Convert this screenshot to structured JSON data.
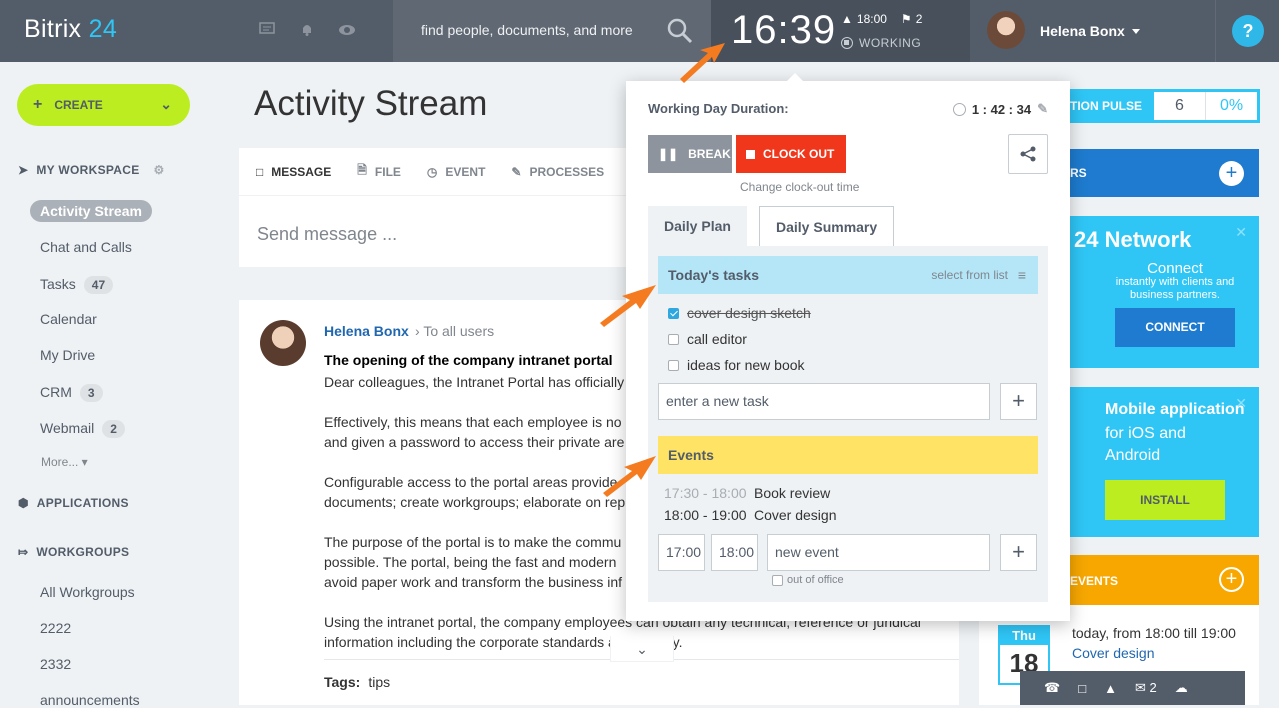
{
  "topbar": {
    "logo_main": "Bitrix",
    "logo_num": "24",
    "search_placeholder": "find people, documents, and more",
    "clock": "16:39",
    "alarm_time": "18:00",
    "flag_count": "2",
    "status": "WORKING",
    "user_name": "Helena Bonx",
    "help": "?"
  },
  "sidebar": {
    "create_label": "CREATE",
    "workspace_label": "MY WORKSPACE",
    "items": [
      {
        "label": "Activity Stream",
        "counter": ""
      },
      {
        "label": "Chat and Calls",
        "counter": ""
      },
      {
        "label": "Tasks",
        "counter": "47"
      },
      {
        "label": "Calendar",
        "counter": ""
      },
      {
        "label": "My Drive",
        "counter": ""
      },
      {
        "label": "CRM",
        "counter": "3"
      },
      {
        "label": "Webmail",
        "counter": "2"
      }
    ],
    "more_label": "More...",
    "applications_label": "APPLICATIONS",
    "workgroups_label": "WORKGROUPS",
    "workgroups": [
      "All Workgroups",
      "2222",
      "2332",
      "announcements"
    ]
  },
  "main": {
    "title": "Activity Stream",
    "composer_tabs": [
      "MESSAGE",
      "FILE",
      "EVENT",
      "PROCESSES"
    ],
    "send_placeholder": "Send message ...",
    "post": {
      "author": "Helena Bonx",
      "to": "To all users",
      "title": "The opening of the company intranet portal",
      "paragraphs": [
        "Dear colleagues, the Intranet Portal has officially",
        "Effectively, this means that each employee is no\nand given a password to access their private are",
        "Configurable access to the portal areas provide\ndocuments; create workgroups; elaborate on rep",
        "The purpose of the portal is to make the commu\npossible. The portal, being the fast and modern\navoid paper work and transform the business inf",
        "Using the intranet portal, the company employees can obtain any technical, reference or juridical\ninformation including the corporate standards and identity."
      ],
      "tags_label": "Tags:",
      "tags": "tips"
    }
  },
  "right": {
    "pulse_label": "TION PULSE",
    "pulse_value": "6",
    "pulse_percent": "0%",
    "widget1_label": "RS",
    "network_title": "24 Network",
    "network_caption": "Connect",
    "network_sub": "instantly with clients and business partners.",
    "connect_label": "CONNECT",
    "mobile_title": "Mobile application",
    "mobile_sub": "for iOS and Android",
    "install_label": "INSTALL",
    "events_label": "EVENTS",
    "cal_dow": "Thu",
    "cal_day": "18",
    "event_line": "today, from 18:00 till 19:00",
    "event_link": "Cover design",
    "mail_count": "2"
  },
  "popup": {
    "wdd_label": "Working Day Duration:",
    "wdd_time": "1 : 42 : 34",
    "break_label": "BREAK",
    "clockout_label": "CLOCK OUT",
    "change_clockout": "Change clock-out time",
    "tab_plan": "Daily Plan",
    "tab_summary": "Daily Summary",
    "tasks_header": "Today's tasks",
    "select_from_list": "select from list",
    "tasks": [
      {
        "label": "cover design sketch",
        "done": true
      },
      {
        "label": "call editor",
        "done": false
      },
      {
        "label": "ideas for new book",
        "done": false
      }
    ],
    "new_task_placeholder": "enter a new task",
    "events_header": "Events",
    "events": [
      {
        "time": "17:30 - 18:00",
        "title": "Book review",
        "past": true
      },
      {
        "time": "18:00 - 19:00",
        "title": "Cover design",
        "past": false
      }
    ],
    "event_from": "17:00",
    "event_to": "18:00",
    "new_event_placeholder": "new event",
    "out_of_office": "out of office"
  },
  "colors": {
    "accent": "#2fc6f6",
    "create": "#bbed21",
    "clockout": "#f0371b",
    "events": "#f7a700",
    "arrow": "#f47b20"
  }
}
